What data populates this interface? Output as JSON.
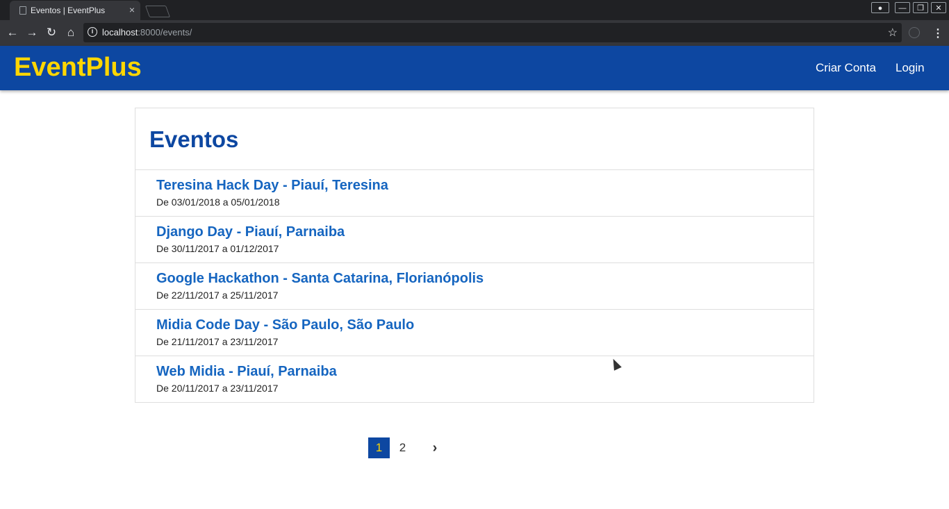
{
  "browser": {
    "tab_title": "Eventos | EventPlus",
    "tab_close": "×",
    "url_host": "localhost",
    "url_rest": ":8000/events/",
    "back_icon": "←",
    "forward_icon": "→",
    "reload_icon": "↻",
    "home_icon": "⌂",
    "star_icon": "☆",
    "menu_icon": "⋮",
    "min_icon": "—",
    "restore_icon": "❐",
    "close_icon": "✕",
    "profile_icon": "●"
  },
  "header": {
    "brand": "EventPlus",
    "nav": [
      "Criar Conta",
      "Login"
    ]
  },
  "main": {
    "title": "Eventos",
    "events": [
      {
        "name": "Teresina Hack Day - Piauí, Teresina",
        "dates": "De 03/01/2018 a 05/01/2018"
      },
      {
        "name": "Django Day - Piauí, Parnaiba",
        "dates": "De 30/11/2017 a 01/12/2017"
      },
      {
        "name": "Google Hackathon - Santa Catarina, Florianópolis",
        "dates": "De 22/11/2017 a 25/11/2017"
      },
      {
        "name": "Midia Code Day - São Paulo, São Paulo",
        "dates": "De 21/11/2017 a 23/11/2017"
      },
      {
        "name": "Web Midia - Piauí, Parnaiba",
        "dates": "De 20/11/2017 a 23/11/2017"
      }
    ]
  },
  "pagination": {
    "pages": [
      "1",
      "2"
    ],
    "current": "1",
    "next_icon": "›"
  },
  "colors": {
    "primary": "#0d47a1",
    "accent": "#ffd600",
    "link": "#1565c0"
  }
}
